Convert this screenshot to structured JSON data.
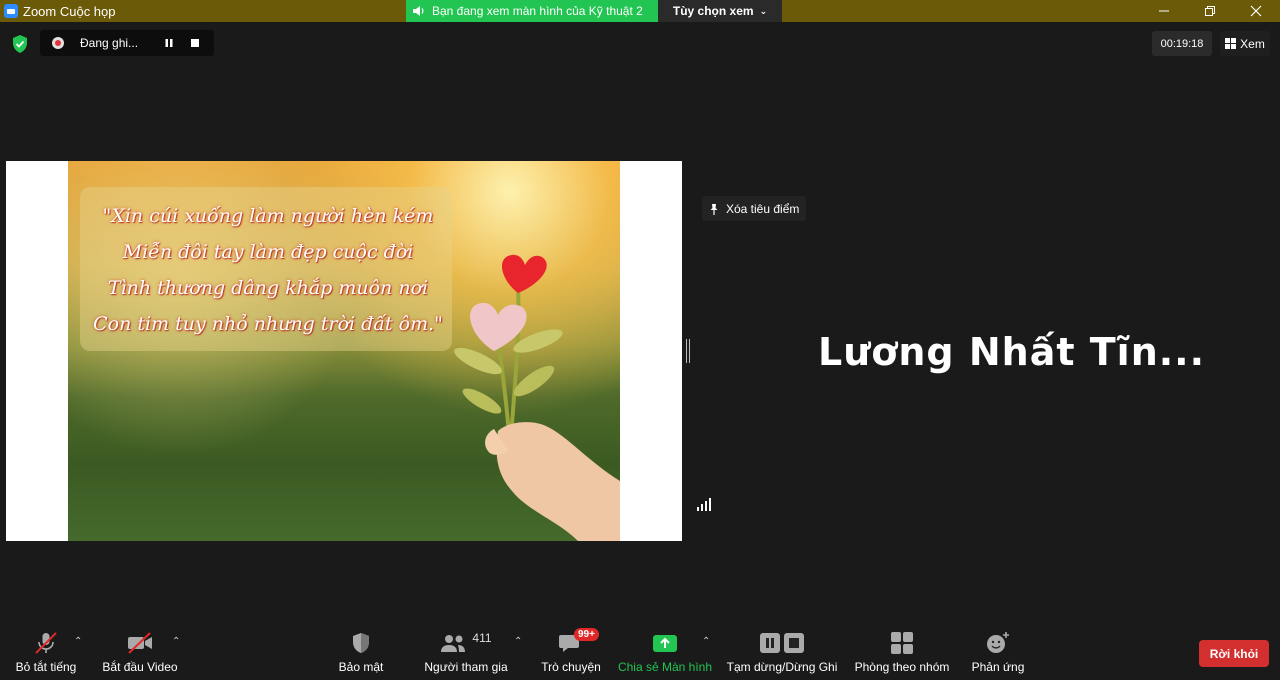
{
  "titlebar": {
    "app_title": "Zoom Cuộc họp",
    "share_banner": "Bạn đang xem màn hình của Kỹ thuật 2",
    "view_options": "Tùy chọn xem"
  },
  "recording": {
    "label": "Đang ghi..."
  },
  "timer": "00:19:18",
  "view_button": "Xem",
  "slide": {
    "quote_lines": [
      "\"Xin cúi xuống làm người hèn kém",
      "Miễn đôi tay làm đẹp cuộc đời",
      "Tình thương dâng khắp muôn nơi",
      "Con tim tuy nhỏ nhưng trời đất ôm.\""
    ]
  },
  "spotlight": {
    "unpin_label": "Xóa tiêu điểm",
    "participant_name": "Lương Nhất Tĩn..."
  },
  "toolbar": {
    "mute_label": "Bỏ tắt tiếng",
    "video_label": "Bắt đầu Video",
    "security_label": "Bảo mật",
    "participants_label": "Người tham gia",
    "participants_count": "411",
    "chat_label": "Trò chuyện",
    "chat_badge": "99+",
    "share_label": "Chia sẻ Màn hình",
    "record_label": "Tạm dừng/Dừng Ghi",
    "breakout_label": "Phòng theo nhóm",
    "reactions_label": "Phản ứng",
    "leave_label": "Rời khỏi"
  },
  "colors": {
    "titlebar": "#6b5a08",
    "share_banner": "#23c552",
    "share_active": "#23c552",
    "leave": "#d32f2f",
    "badge": "#e02828"
  }
}
